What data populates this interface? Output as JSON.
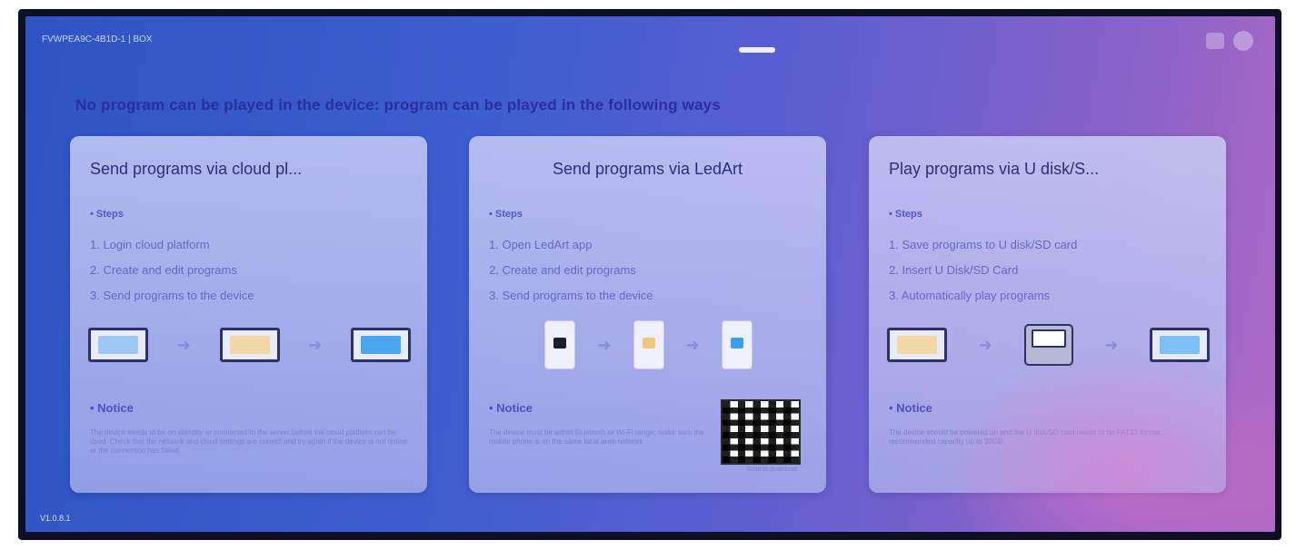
{
  "status_bar": {
    "text": "FVWPEA9C-4B1D-1 | BOX"
  },
  "headline": "No program can be played in the device: program can be played in the following ways",
  "cards": [
    {
      "title": "Send programs via cloud pl...",
      "steps_label": "• Steps",
      "steps": [
        "1. Login cloud platform",
        "2. Create and edit programs",
        "3. Send programs to the device"
      ],
      "notice_label": "• Notice",
      "notice_text": "The device needs to be on standby or connected to the server before the cloud platform can be used. Check that the network and cloud settings are correct and try again if the device is not online or the connection has failed."
    },
    {
      "title": "Send programs via LedArt",
      "steps_label": "• Steps",
      "steps": [
        "1. Open LedArt app",
        "2. Create and edit programs",
        "3. Send programs to the device"
      ],
      "notice_label": "• Notice",
      "notice_text": "The device must be within Bluetooth or Wi-Fi range; make sure the mobile phone is on the same local area network.",
      "qr_caption": "Scan to download"
    },
    {
      "title": "Play programs via U disk/S...",
      "steps_label": "• Steps",
      "steps": [
        "1. Save programs to U disk/SD card",
        "2. Insert U Disk/SD Card",
        "3. Automatically play programs"
      ],
      "notice_label": "• Notice",
      "notice_text": "The device should be powered on and the U disk/SD card needs to be FAT32 format; recommended capacity up to 32GB."
    }
  ],
  "version": "V1.0.8.1",
  "colors": {
    "headline": "#2b2f9e",
    "card_title": "#2d2f7a",
    "accent": "#4b52c0"
  }
}
